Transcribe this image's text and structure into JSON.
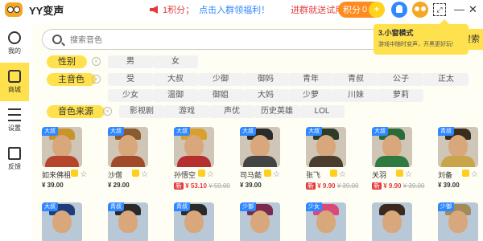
{
  "app": {
    "title": "YY变声"
  },
  "notice": {
    "text": "1积分；",
    "link": "点击入群领福利！",
    "cta": "进群就送试用"
  },
  "header": {
    "points_label": "积分",
    "points_value": "0",
    "plus": "+",
    "mini_label": "⤢"
  },
  "tooltip": {
    "title": "3.小窗模式",
    "body": "游戏中随时变声，开黑更好玩!"
  },
  "sidebar": {
    "items": [
      {
        "label": "我的",
        "icon": "user-icon"
      },
      {
        "label": "商城",
        "icon": "shop-icon"
      },
      {
        "label": "设置",
        "icon": "settings-icon"
      },
      {
        "label": "反馈",
        "icon": "feedback-icon"
      }
    ]
  },
  "search": {
    "placeholder": "搜索音色",
    "button": "搜索"
  },
  "filters": {
    "gender": {
      "label": "性别",
      "clear": "×",
      "options": [
        "男",
        "女"
      ]
    },
    "voice": {
      "label": "主音色",
      "clear": "×",
      "options": [
        "受",
        "大叔",
        "少御",
        "御妈",
        "青年",
        "青叔",
        "公子",
        "正太",
        "少女",
        "温御",
        "御姐",
        "大妈",
        "少萝",
        "川妹",
        "萝莉"
      ]
    },
    "source": {
      "label": "音色来源",
      "clear": "×",
      "options": [
        "影视剧",
        "游戏",
        "声优",
        "历史英雄",
        "LOL"
      ]
    }
  },
  "cards": [
    {
      "name": "如来佛祖",
      "tag": "大叔",
      "price": "¥ 39.00",
      "sale": false,
      "hat": "#c7942a",
      "body": "#b5462c"
    },
    {
      "name": "沙僧",
      "tag": "大叔",
      "price": "¥ 29.00",
      "sale": false,
      "hat": "#8a5b2e",
      "body": "#a14a2a"
    },
    {
      "name": "孙悟空",
      "tag": "大叔",
      "price": "¥ 53.10",
      "old": "¥ 59.00",
      "sale": true,
      "hat": "#d9a12b",
      "body": "#b52f2f"
    },
    {
      "name": "司马懿",
      "tag": "大叔",
      "price": "¥ 39.00",
      "sale": false,
      "hat": "#2a2a2a",
      "body": "#444"
    },
    {
      "name": "张飞",
      "tag": "大叔",
      "price": "¥ 9.90",
      "old": "¥ 39.00",
      "sale": true,
      "hat": "#2d3b2a",
      "body": "#4a3d2e"
    },
    {
      "name": "关羽",
      "tag": "大叔",
      "price": "¥ 9.90",
      "old": "¥ 39.00",
      "sale": true,
      "hat": "#2a6b3a",
      "body": "#2f7a40"
    },
    {
      "name": "刘备",
      "tag": "青叔",
      "price": "¥ 39.00",
      "sale": false,
      "hat": "#3a2d1e",
      "body": "#c9a54a"
    }
  ],
  "cards_row2": [
    {
      "tag": "大叔",
      "hat": "#1f3d7a"
    },
    {
      "tag": "青叔",
      "hat": "#2a2a2a"
    },
    {
      "tag": "青叔",
      "hat": "#2a2a2a"
    },
    {
      "tag": "少御",
      "hat": "#7a2a4a"
    },
    {
      "tag": "少女",
      "hat": "#d94a7a"
    },
    {
      "tag": "",
      "hat": "#3a2a1e"
    },
    {
      "tag": "少御",
      "hat": "#a38a5a"
    }
  ],
  "colors": {
    "accent": "#ffe14d",
    "orange": "#ff8a1e",
    "blue": "#2f88ff",
    "red": "#e23b3b"
  }
}
